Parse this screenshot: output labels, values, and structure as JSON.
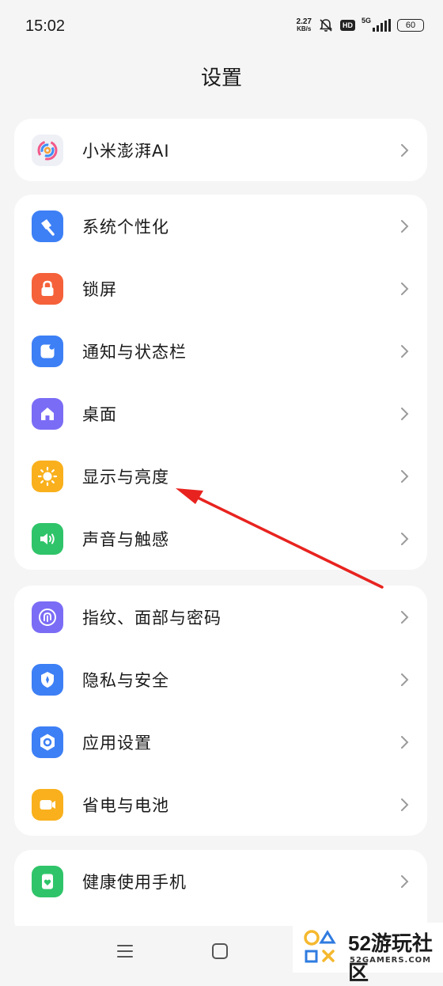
{
  "status_bar": {
    "time": "15:02",
    "net_speed_value": "2.27",
    "net_speed_unit": "KB/s",
    "hd": "HD",
    "network": "5G",
    "battery": "60"
  },
  "header": {
    "title": "设置"
  },
  "groups": [
    {
      "items": [
        {
          "label": "小米澎湃AI",
          "icon": "hyperos-ai-icon"
        }
      ]
    },
    {
      "items": [
        {
          "label": "系统个性化",
          "icon": "brush-icon",
          "color": "#3d7ff5"
        },
        {
          "label": "锁屏",
          "icon": "lock-icon",
          "color": "#f5613a"
        },
        {
          "label": "通知与状态栏",
          "icon": "notification-icon",
          "color": "#3d7ff5"
        },
        {
          "label": "桌面",
          "icon": "home-icon",
          "color": "#7b6cf6"
        },
        {
          "label": "显示与亮度",
          "icon": "sun-icon",
          "color": "#f9b01c"
        },
        {
          "label": "声音与触感",
          "icon": "speaker-icon",
          "color": "#2fc469"
        }
      ]
    },
    {
      "items": [
        {
          "label": "指纹、面部与密码",
          "icon": "fingerprint-icon",
          "color": "#7b6cf6"
        },
        {
          "label": "隐私与安全",
          "icon": "privacy-shield-icon",
          "color": "#3d7ff5"
        },
        {
          "label": "应用设置",
          "icon": "app-settings-icon",
          "color": "#3d7ff5"
        },
        {
          "label": "省电与电池",
          "icon": "battery-icon",
          "color": "#f9b01c"
        }
      ]
    },
    {
      "items": [
        {
          "label": "健康使用手机",
          "icon": "heart-phone-icon",
          "color": "#2fc469"
        }
      ]
    }
  ],
  "watermark": {
    "number": "52",
    "text": "游玩社区",
    "sub": "52GAMERS.COM"
  },
  "colors": {
    "arrow": "#e8231f",
    "background": "#f5f5f5",
    "card": "#ffffff"
  }
}
